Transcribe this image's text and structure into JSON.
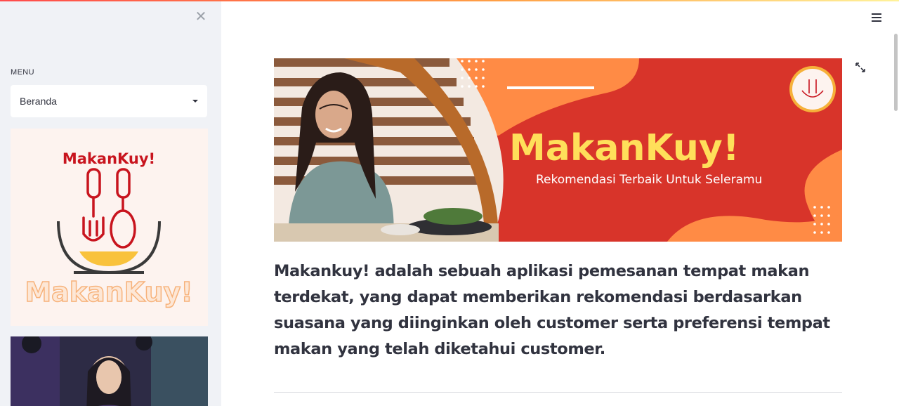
{
  "sidebar": {
    "menu_label": "MENU",
    "select": {
      "value": "Beranda"
    },
    "logo": {
      "title": "MakanKuy!",
      "bottom_text": "MakanKuy!"
    }
  },
  "banner": {
    "title": "MakanKuy!",
    "subtitle": "Rekomendasi Terbaik Untuk Seleramu"
  },
  "main": {
    "description": "Makankuy! adalah sebuah aplikasi pemesanan tempat makan terdekat, yang dapat memberikan rekomendasi berdasarkan suasana yang diinginkan oleh customer serta preferensi tempat makan yang telah diketahui customer."
  },
  "colors": {
    "accent_red": "#d8342a",
    "accent_orange": "#ff8b45",
    "accent_yellow": "#ffdf5a",
    "sidebar_bg": "#f0f2f6",
    "text": "#31333f"
  },
  "icons": {
    "close": "close-icon",
    "dropdown": "chevron-down-icon",
    "menu": "hamburger-icon",
    "expand": "fullscreen-icon"
  }
}
